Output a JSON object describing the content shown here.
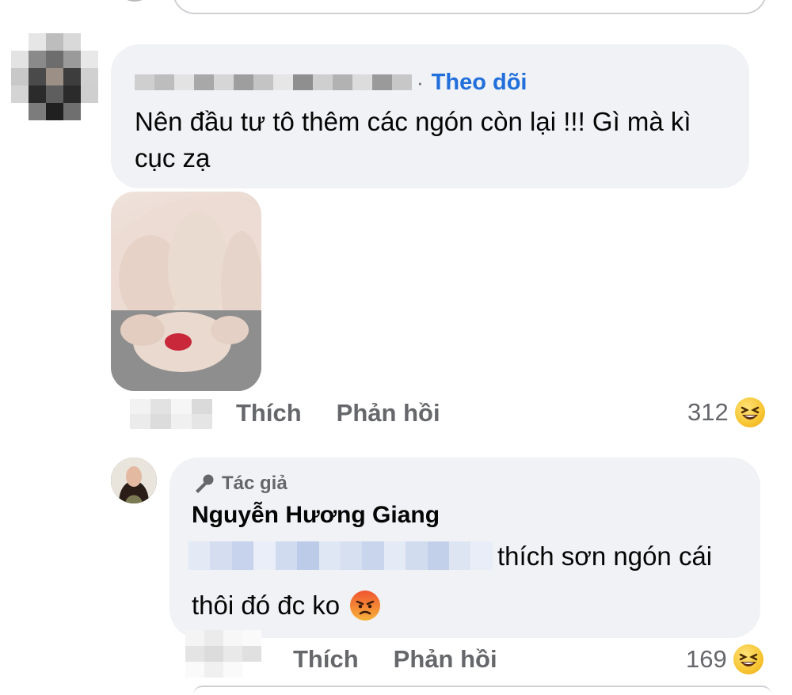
{
  "comment1": {
    "follow_label": "Theo dõi",
    "separator": "·",
    "text": "Nên đầu tư tô thêm các ngón còn lại !!! Gì mà kì cục zạ",
    "actions": {
      "like": "Thích",
      "reply": "Phản hồi"
    },
    "reaction_count": "312",
    "reaction_icon": "laughing-emoji-icon"
  },
  "reply1": {
    "author_badge": "Tác giả",
    "author_name": "Nguyễn Hương Giang",
    "text_line1": "thích sơn ngón cái",
    "text_line2": "thôi đó đc ko",
    "text_emoji": "angry-emoji-icon",
    "actions": {
      "like": "Thích",
      "reply": "Phản hồi"
    },
    "reaction_count": "169",
    "reaction_icon": "laughing-emoji-icon"
  },
  "colors": {
    "bubble": "#f0f2f5",
    "follow": "#216fdb",
    "muted": "#65676b",
    "text": "#050505"
  }
}
